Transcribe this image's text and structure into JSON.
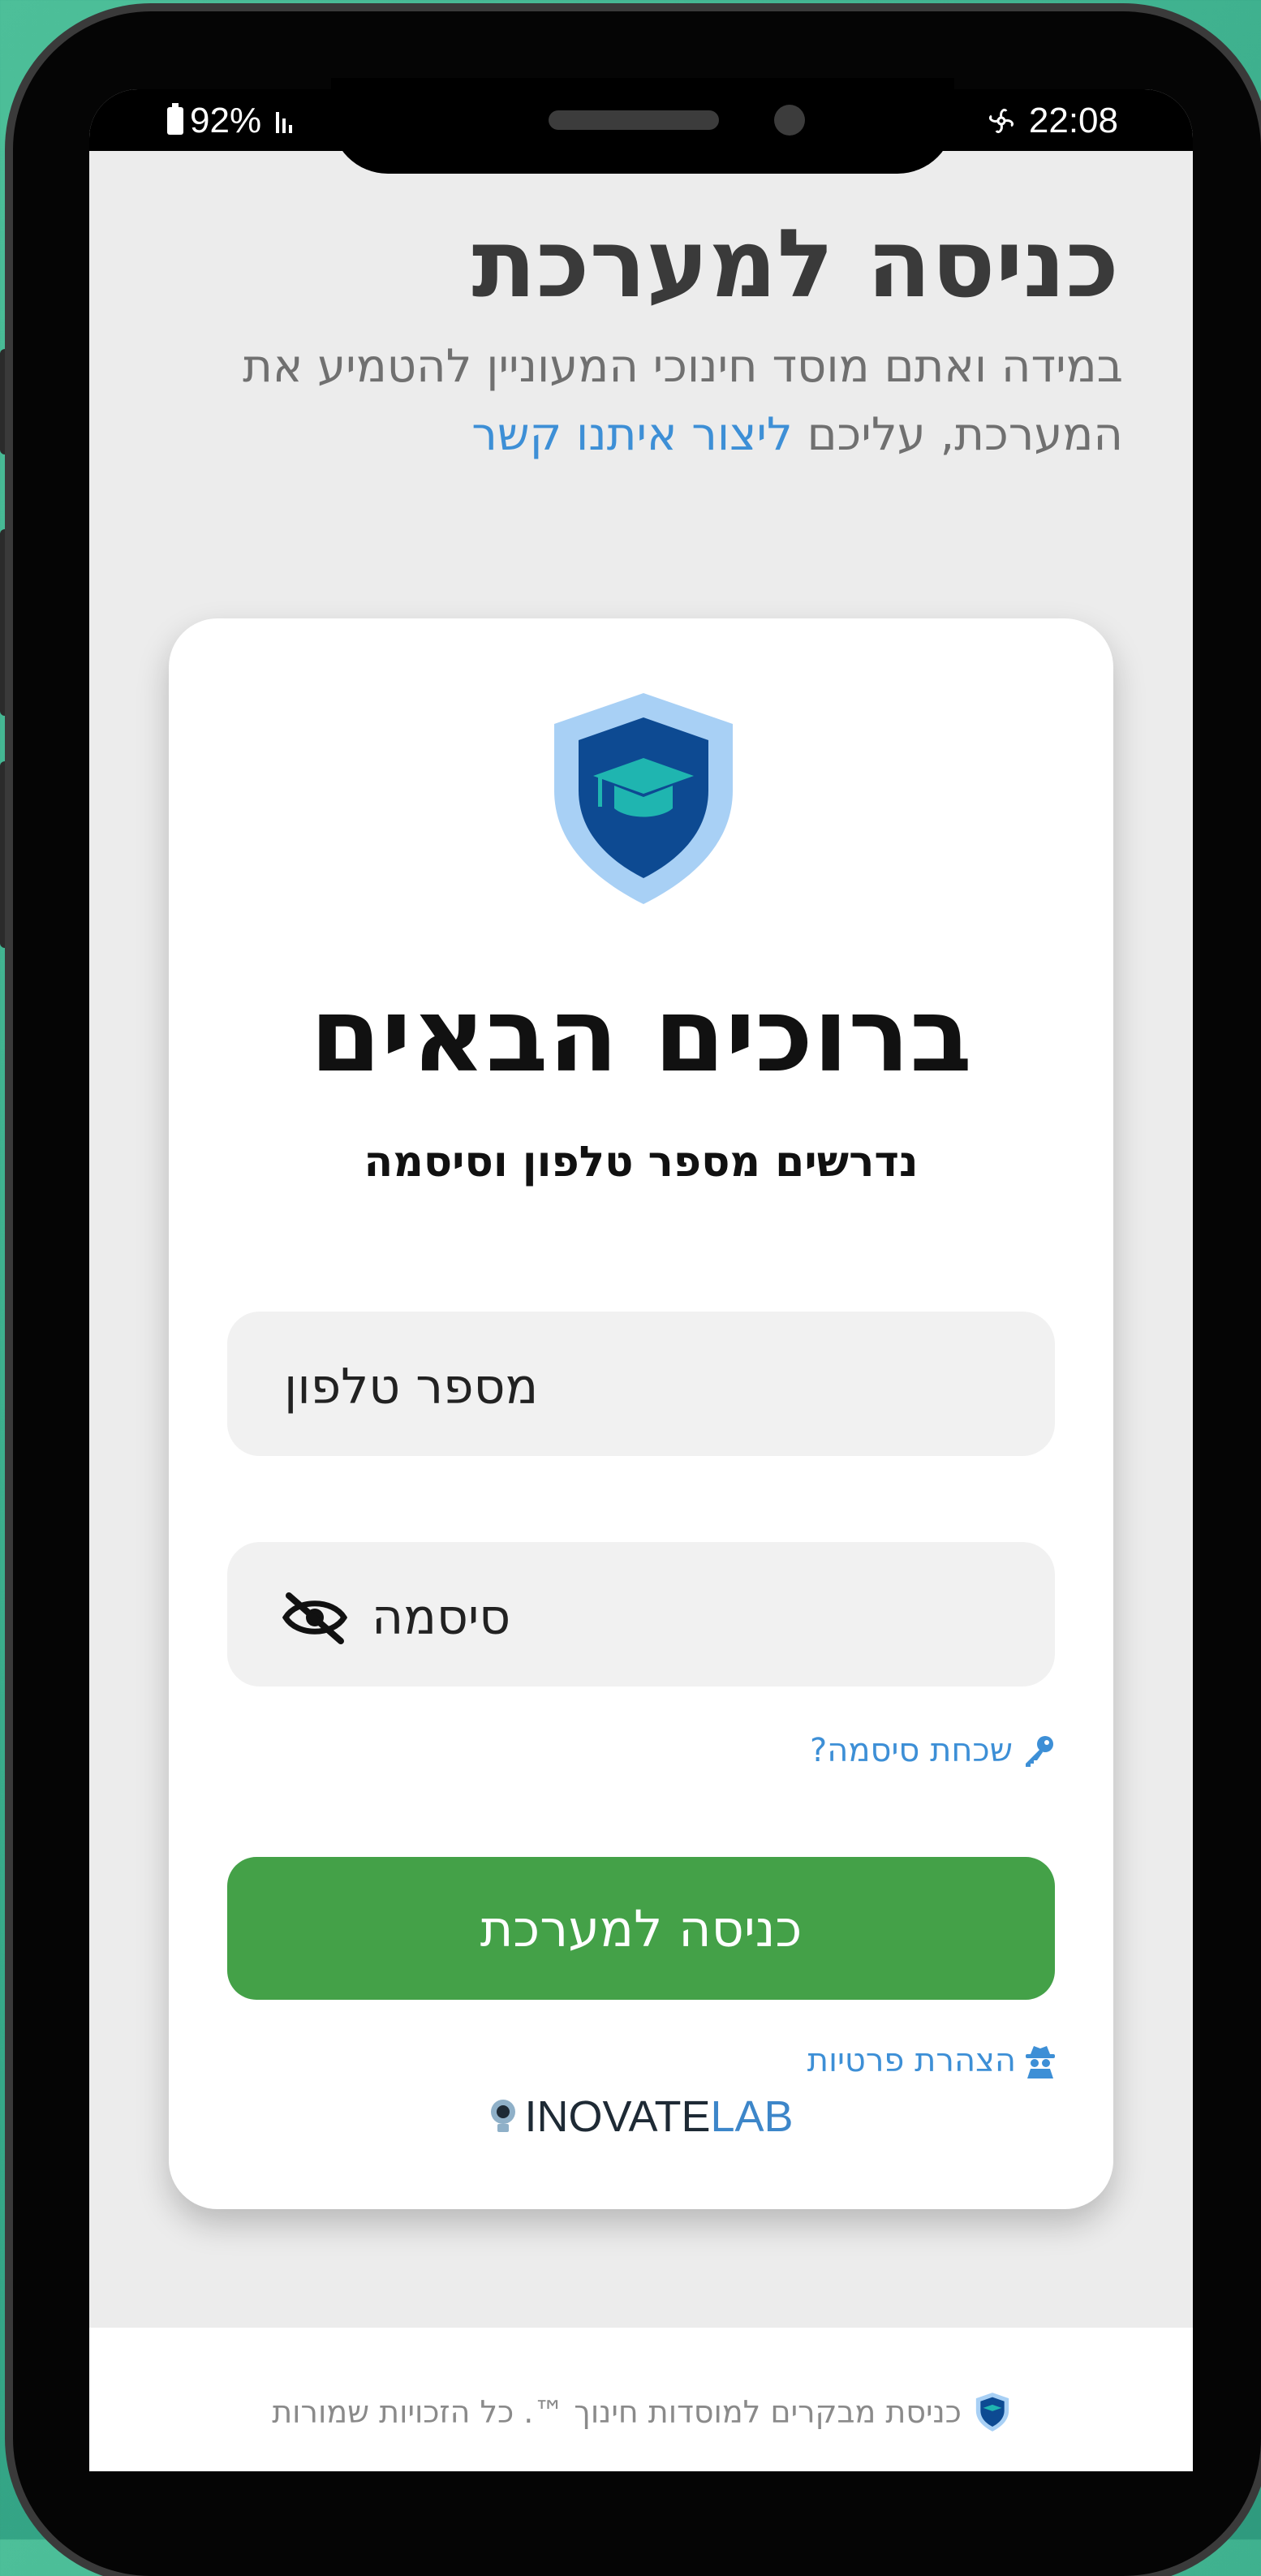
{
  "status_bar": {
    "battery_percent": "92%",
    "time": "22:08",
    "icons": [
      "battery-icon",
      "signal-icon",
      "fan-icon"
    ]
  },
  "header": {
    "title": "כניסה למערכת",
    "subtitle_text": "במידה ואתם מוסד חינוכי המעוניין להטמיע את המערכת, עליכם",
    "subtitle_link": "ליצור איתנו קשר"
  },
  "login_card": {
    "welcome": "ברוכים הבאים",
    "instructions": "נדרשים מספר טלפון וסיסמה",
    "phone_placeholder": "מספר טלפון",
    "password_placeholder": "סיסמה",
    "forgot_password": "שכחת סיסמה?",
    "login_button": "כניסה למערכת",
    "privacy_statement": "הצהרת פרטיות",
    "brand_part1": "INOVATE",
    "brand_part2": "LAB"
  },
  "footer": {
    "text": "כניסת מבקרים למוסדות חינוך ™. כל הזכויות שמורות"
  },
  "colors": {
    "background": "#3fb491",
    "accent_blue": "#3d8fd6",
    "button_green": "#44a148",
    "shield_dark": "#0d4a92",
    "shield_light": "#a8d0f5",
    "cap_teal": "#1fb5b0"
  }
}
